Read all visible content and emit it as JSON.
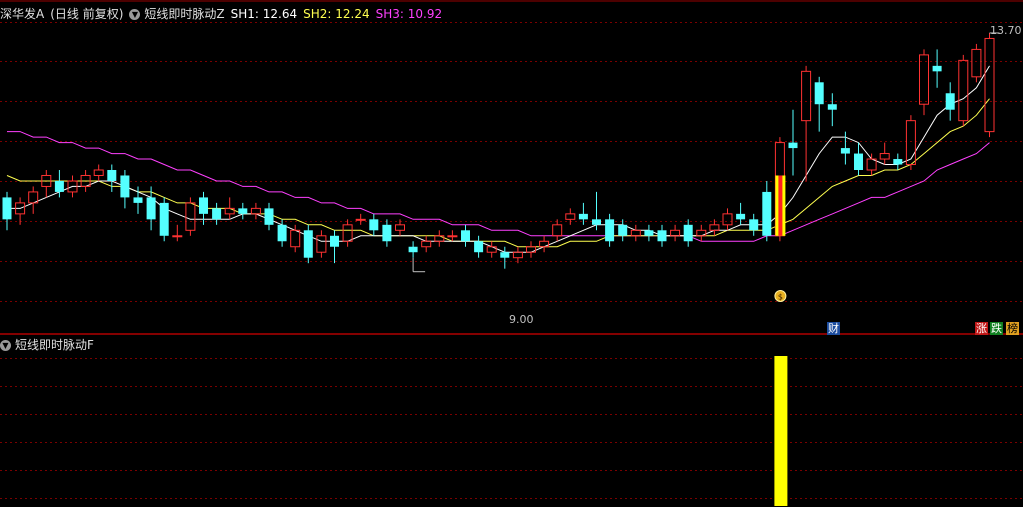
{
  "main_header": {
    "stock": "深华发A",
    "period": "(日线 前复权)",
    "indicator": "短线即时脉动Z",
    "sh1": "SH1: 12.64",
    "sh2": "SH2: 12.24",
    "sh3": "SH3: 10.92"
  },
  "sub_header": {
    "indicator": "短线即时脉动F"
  },
  "colors": {
    "up": "#ff3232",
    "down": "#54ffff",
    "ma1": "#ffffff",
    "ma2": "#ffff50",
    "ma3": "#ff40ff",
    "grid": "#7a0000",
    "signal": "#ffff00"
  },
  "markers": {
    "high_label": "13.70",
    "low_label": "9.00",
    "coin_icon": "money-bag-icon",
    "tag_cai": "财",
    "tag_zhang": "涨",
    "tag_die": "跌",
    "tag_bang": "榜"
  },
  "chart_data": {
    "type": "candlestick",
    "price_range": [
      8.6,
      14.0
    ],
    "candles": [
      [
        10.8,
        10.4,
        10.9,
        10.2
      ],
      [
        10.5,
        10.7,
        10.8,
        10.3
      ],
      [
        10.7,
        10.9,
        11.0,
        10.5
      ],
      [
        11.0,
        11.2,
        11.3,
        10.8
      ],
      [
        11.1,
        10.9,
        11.3,
        10.8
      ],
      [
        10.9,
        11.1,
        11.2,
        10.8
      ],
      [
        11.0,
        11.2,
        11.3,
        10.9
      ],
      [
        11.2,
        11.3,
        11.4,
        11.1
      ],
      [
        11.3,
        11.1,
        11.4,
        10.9
      ],
      [
        11.2,
        10.8,
        11.3,
        10.6
      ],
      [
        10.8,
        10.7,
        11.0,
        10.5
      ],
      [
        10.8,
        10.4,
        11.0,
        10.2
      ],
      [
        10.7,
        10.1,
        10.8,
        10.0
      ],
      [
        10.1,
        10.1,
        10.3,
        10.0
      ],
      [
        10.2,
        10.7,
        10.8,
        10.1
      ],
      [
        10.8,
        10.5,
        10.9,
        10.3
      ],
      [
        10.6,
        10.4,
        10.7,
        10.3
      ],
      [
        10.5,
        10.6,
        10.8,
        10.4
      ],
      [
        10.6,
        10.5,
        10.7,
        10.4
      ],
      [
        10.5,
        10.6,
        10.7,
        10.4
      ],
      [
        10.6,
        10.3,
        10.7,
        10.2
      ],
      [
        10.3,
        10.0,
        10.4,
        9.9
      ],
      [
        9.9,
        10.2,
        10.3,
        9.8
      ],
      [
        10.2,
        9.7,
        10.3,
        9.6
      ],
      [
        9.8,
        10.1,
        10.2,
        9.7
      ],
      [
        10.1,
        9.9,
        10.2,
        9.6
      ],
      [
        10.0,
        10.3,
        10.4,
        9.9
      ],
      [
        10.4,
        10.4,
        10.5,
        10.3
      ],
      [
        10.4,
        10.2,
        10.5,
        10.1
      ],
      [
        10.3,
        10.0,
        10.4,
        9.9
      ],
      [
        10.2,
        10.3,
        10.4,
        10.1
      ],
      [
        9.9,
        9.8,
        10.0,
        9.7
      ],
      [
        9.9,
        10.0,
        10.1,
        9.8
      ],
      [
        10.0,
        10.1,
        10.2,
        9.9
      ],
      [
        10.1,
        10.1,
        10.2,
        10.0
      ],
      [
        10.2,
        10.0,
        10.3,
        9.9
      ],
      [
        10.0,
        9.8,
        10.1,
        9.7
      ],
      [
        9.8,
        9.9,
        10.0,
        9.7
      ],
      [
        9.8,
        9.7,
        9.9,
        9.5
      ],
      [
        9.7,
        9.8,
        9.9,
        9.6
      ],
      [
        9.8,
        9.9,
        10.0,
        9.7
      ],
      [
        9.9,
        10.0,
        10.1,
        9.8
      ],
      [
        10.1,
        10.3,
        10.4,
        10.0
      ],
      [
        10.4,
        10.5,
        10.6,
        10.3
      ],
      [
        10.5,
        10.4,
        10.7,
        10.3
      ],
      [
        10.4,
        10.3,
        10.9,
        10.2
      ],
      [
        10.4,
        10.0,
        10.5,
        9.9
      ],
      [
        10.3,
        10.1,
        10.4,
        10.0
      ],
      [
        10.1,
        10.2,
        10.3,
        10.0
      ],
      [
        10.2,
        10.1,
        10.3,
        10.0
      ],
      [
        10.2,
        10.0,
        10.3,
        9.9
      ],
      [
        10.1,
        10.2,
        10.3,
        10.0
      ],
      [
        10.3,
        10.0,
        10.4,
        9.9
      ],
      [
        10.1,
        10.2,
        10.3,
        10.0
      ],
      [
        10.2,
        10.3,
        10.4,
        10.1
      ],
      [
        10.3,
        10.5,
        10.6,
        10.2
      ],
      [
        10.5,
        10.4,
        10.7,
        10.3
      ],
      [
        10.4,
        10.2,
        10.5,
        10.1
      ],
      [
        10.9,
        10.1,
        11.1,
        10.0
      ],
      [
        10.1,
        11.8,
        11.9,
        10.0
      ],
      [
        11.8,
        11.7,
        12.4,
        11.2
      ],
      [
        12.2,
        13.1,
        13.2,
        11.1
      ],
      [
        12.9,
        12.5,
        13.0,
        12.0
      ],
      [
        12.5,
        12.4,
        12.7,
        12.1
      ],
      [
        11.7,
        11.6,
        12.0,
        11.4
      ],
      [
        11.6,
        11.3,
        11.8,
        11.2
      ],
      [
        11.3,
        11.5,
        11.6,
        11.2
      ],
      [
        11.5,
        11.6,
        11.8,
        11.4
      ],
      [
        11.5,
        11.4,
        11.6,
        11.3
      ],
      [
        11.4,
        12.2,
        12.3,
        11.3
      ],
      [
        12.5,
        13.4,
        13.5,
        12.3
      ],
      [
        13.2,
        13.1,
        13.5,
        12.8
      ],
      [
        12.7,
        12.4,
        12.9,
        12.2
      ],
      [
        12.2,
        13.3,
        13.4,
        12.1
      ],
      [
        13.0,
        13.5,
        13.6,
        12.9
      ],
      [
        12.0,
        13.7,
        13.8,
        11.9
      ]
    ],
    "ma1": [
      10.6,
      10.6,
      10.7,
      10.8,
      10.9,
      11.0,
      11.0,
      11.1,
      11.1,
      11.0,
      10.9,
      10.8,
      10.6,
      10.5,
      10.4,
      10.4,
      10.4,
      10.4,
      10.5,
      10.5,
      10.4,
      10.3,
      10.2,
      10.1,
      10.0,
      10.0,
      10.0,
      10.1,
      10.1,
      10.1,
      10.1,
      10.1,
      10.0,
      10.0,
      10.0,
      10.0,
      10.0,
      9.9,
      9.8,
      9.8,
      9.8,
      9.9,
      10.0,
      10.1,
      10.2,
      10.3,
      10.3,
      10.3,
      10.2,
      10.2,
      10.1,
      10.1,
      10.1,
      10.1,
      10.2,
      10.2,
      10.3,
      10.3,
      10.3,
      10.5,
      10.8,
      11.2,
      11.6,
      11.9,
      11.9,
      11.8,
      11.5,
      11.4,
      11.4,
      11.5,
      11.9,
      12.3,
      12.5,
      12.6,
      12.8,
      13.2
    ],
    "ma2": [
      11.2,
      11.1,
      11.1,
      11.1,
      11.1,
      11.1,
      11.1,
      11.1,
      11.0,
      11.0,
      10.9,
      10.9,
      10.8,
      10.7,
      10.7,
      10.6,
      10.6,
      10.6,
      10.5,
      10.5,
      10.5,
      10.4,
      10.4,
      10.3,
      10.3,
      10.2,
      10.2,
      10.2,
      10.1,
      10.1,
      10.1,
      10.1,
      10.1,
      10.1,
      10.0,
      10.0,
      10.0,
      10.0,
      10.0,
      9.9,
      9.9,
      9.9,
      9.9,
      10.0,
      10.0,
      10.0,
      10.1,
      10.1,
      10.1,
      10.1,
      10.1,
      10.1,
      10.1,
      10.1,
      10.1,
      10.2,
      10.2,
      10.2,
      10.2,
      10.3,
      10.4,
      10.6,
      10.8,
      11.0,
      11.1,
      11.2,
      11.2,
      11.3,
      11.3,
      11.4,
      11.6,
      11.8,
      12.0,
      12.1,
      12.3,
      12.6
    ],
    "ma3": [
      12.0,
      12.0,
      11.9,
      11.9,
      11.8,
      11.8,
      11.7,
      11.7,
      11.6,
      11.6,
      11.5,
      11.5,
      11.4,
      11.3,
      11.3,
      11.2,
      11.1,
      11.1,
      11.0,
      11.0,
      10.9,
      10.9,
      10.8,
      10.8,
      10.7,
      10.7,
      10.6,
      10.6,
      10.5,
      10.5,
      10.5,
      10.4,
      10.4,
      10.4,
      10.3,
      10.3,
      10.3,
      10.2,
      10.2,
      10.2,
      10.1,
      10.1,
      10.1,
      10.1,
      10.1,
      10.1,
      10.1,
      10.1,
      10.1,
      10.1,
      10.1,
      10.1,
      10.1,
      10.0,
      10.0,
      10.0,
      10.0,
      10.0,
      10.1,
      10.1,
      10.2,
      10.3,
      10.4,
      10.5,
      10.6,
      10.7,
      10.8,
      10.8,
      10.9,
      11.0,
      11.1,
      11.3,
      11.4,
      11.5,
      11.6,
      11.8
    ],
    "signal_index": 59,
    "high_index": 75,
    "low_index": 31
  }
}
